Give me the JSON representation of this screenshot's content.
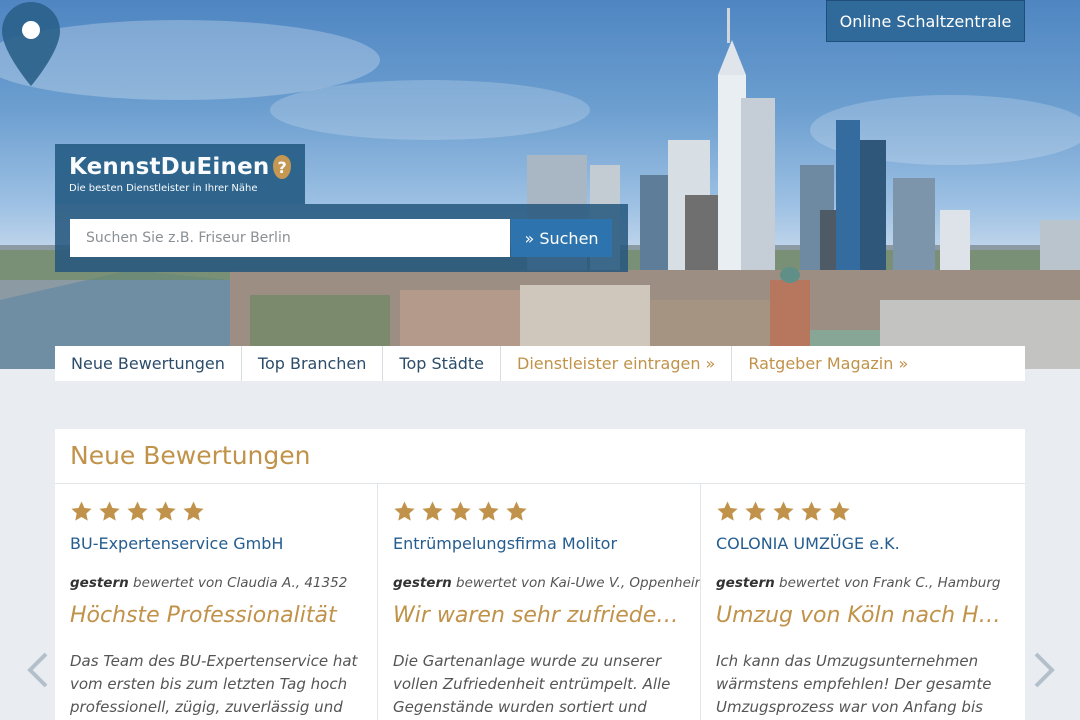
{
  "header": {
    "online_button": "Online Schaltzentrale",
    "logo_title": "KennstDuEinen",
    "logo_subtitle": "Die besten Dienstleister in Ihrer Nähe"
  },
  "search": {
    "placeholder": "Suchen Sie z.B. Friseur Berlin",
    "button": "» Suchen"
  },
  "nav": [
    {
      "label": "Neue Bewertungen"
    },
    {
      "label": "Top Branchen"
    },
    {
      "label": "Top Städte"
    },
    {
      "label": "Dienstleister eintragen »"
    },
    {
      "label": "Ratgeber Magazin »"
    }
  ],
  "reviews": {
    "title": "Neue Bewertungen",
    "rating_max": 5,
    "cards": [
      {
        "stars": 5,
        "company": "BU-Expertenservice GmbH",
        "when": "gestern",
        "by": "bewertet von Claudia A., 41352",
        "headline": "Höchste Professionalität",
        "text": "Das Team des BU-Expertenservice hat vom ersten bis zum letzten Tag hoch professionell, zügig, zuverlässig und vor"
      },
      {
        "stars": 5,
        "company": "Entrümpelungsfirma Molitor",
        "when": "gestern",
        "by": "bewertet von Kai-Uwe V., Oppenheim",
        "headline": "Wir waren sehr zufrieden ...",
        "text": "Die Gartenanlage wurde zu unserer vollen Zufriedenheit entrümpelt. Alle Gegenstände wurden sortiert und"
      },
      {
        "stars": 5,
        "company": "COLONIA UMZÜGE e.K.",
        "when": "gestern",
        "by": "bewertet von Frank C., Hamburg",
        "headline": "Umzug von Köln nach Ha...",
        "text": "Ich kann das Umzugsunternehmen wärmstens empfehlen! Der gesamte Umzugsprozess war von Anfang bis Ende"
      }
    ]
  },
  "colors": {
    "brand_blue": "#2a6189",
    "accent_gold": "#c0924a",
    "link_blue": "#255d8f",
    "page_bg": "#e9edf1"
  },
  "icons": {
    "star": "star-icon",
    "prev": "chevron-left-icon",
    "next": "chevron-right-icon",
    "pin": "map-pin-icon"
  }
}
